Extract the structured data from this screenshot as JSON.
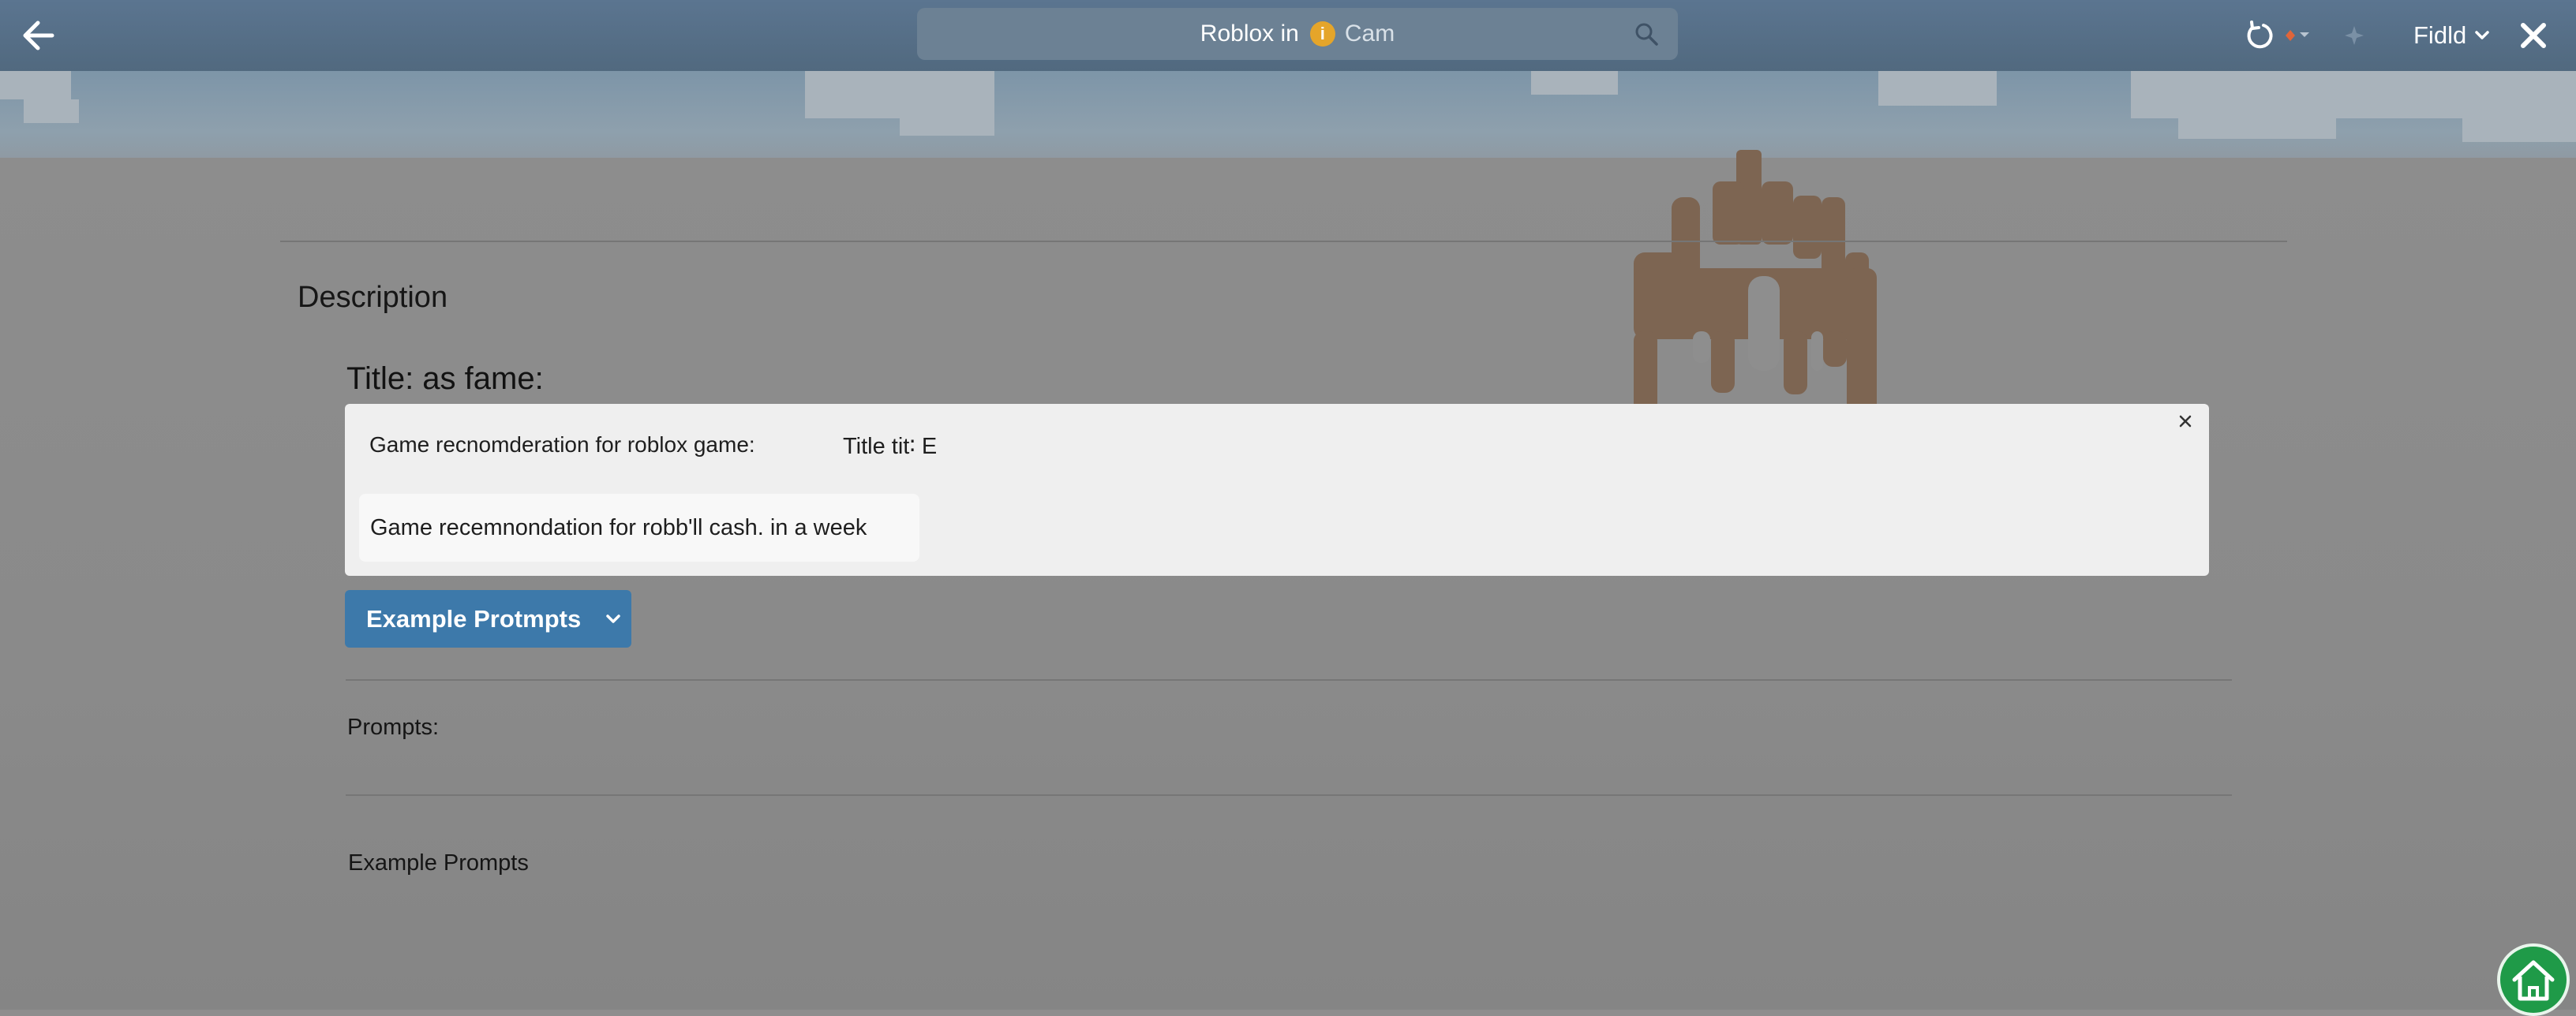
{
  "topbar": {
    "back_icon": "arrow-left-icon",
    "search": {
      "query_part1": "Roblox in",
      "badge_glyph": "i",
      "query_part2": "Cam",
      "icon": "search-icon"
    },
    "refresh_icon": "refresh-icon",
    "dot_dropdown_icon": "orange-dot-chevron-icon",
    "star_icon": "star-icon",
    "field_menu_label": "Fidld",
    "close_icon": "close-icon"
  },
  "content": {
    "description_heading": "Description",
    "title_heading": "Title: as fame:",
    "dialog": {
      "left_label": "Game recnomderation for roblox game:",
      "right_label": "Title tit∶ E",
      "prompt_chip": "Game recemnondation for robb'll cash. in a week",
      "close_icon": "close-icon"
    },
    "example_button_label": "Example Protmpts",
    "prompts_label": "Prompts:",
    "example_prompts_label": "Example Prompts"
  },
  "fab": {
    "icon": "home-icon"
  },
  "colors": {
    "topbar": "#54708a",
    "primary_button": "#3d79aa",
    "home_fab": "#1f9a48",
    "badge": "#e5a52a",
    "accent_dot": "#e0653a"
  }
}
